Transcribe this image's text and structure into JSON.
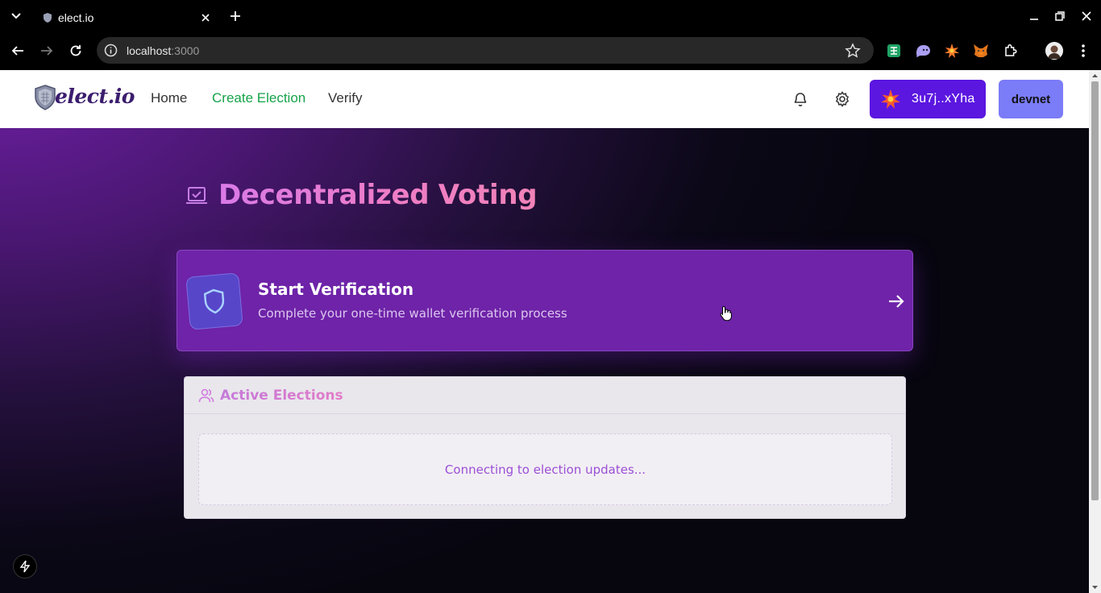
{
  "browser": {
    "tab_title": "elect.io",
    "url_host": "localhost",
    "url_port": ":3000"
  },
  "header": {
    "logo_text": "elect.io",
    "nav": [
      {
        "label": "Home",
        "active": false
      },
      {
        "label": "Create Election",
        "active": true
      },
      {
        "label": "Verify",
        "active": false
      }
    ],
    "wallet_label": "3u7j..xYha",
    "network_label": "devnet"
  },
  "hero": {
    "title": "Decentralized Voting"
  },
  "verification_card": {
    "title": "Start Verification",
    "subtitle": "Complete your one-time wallet verification process"
  },
  "elections": {
    "title": "Active Elections",
    "status": "Connecting to election updates..."
  },
  "colors": {
    "brand_purple": "#6e23a8",
    "wallet_button": "#5b16e0",
    "network_button": "#7b7cf7",
    "active_nav": "#16a34a"
  }
}
